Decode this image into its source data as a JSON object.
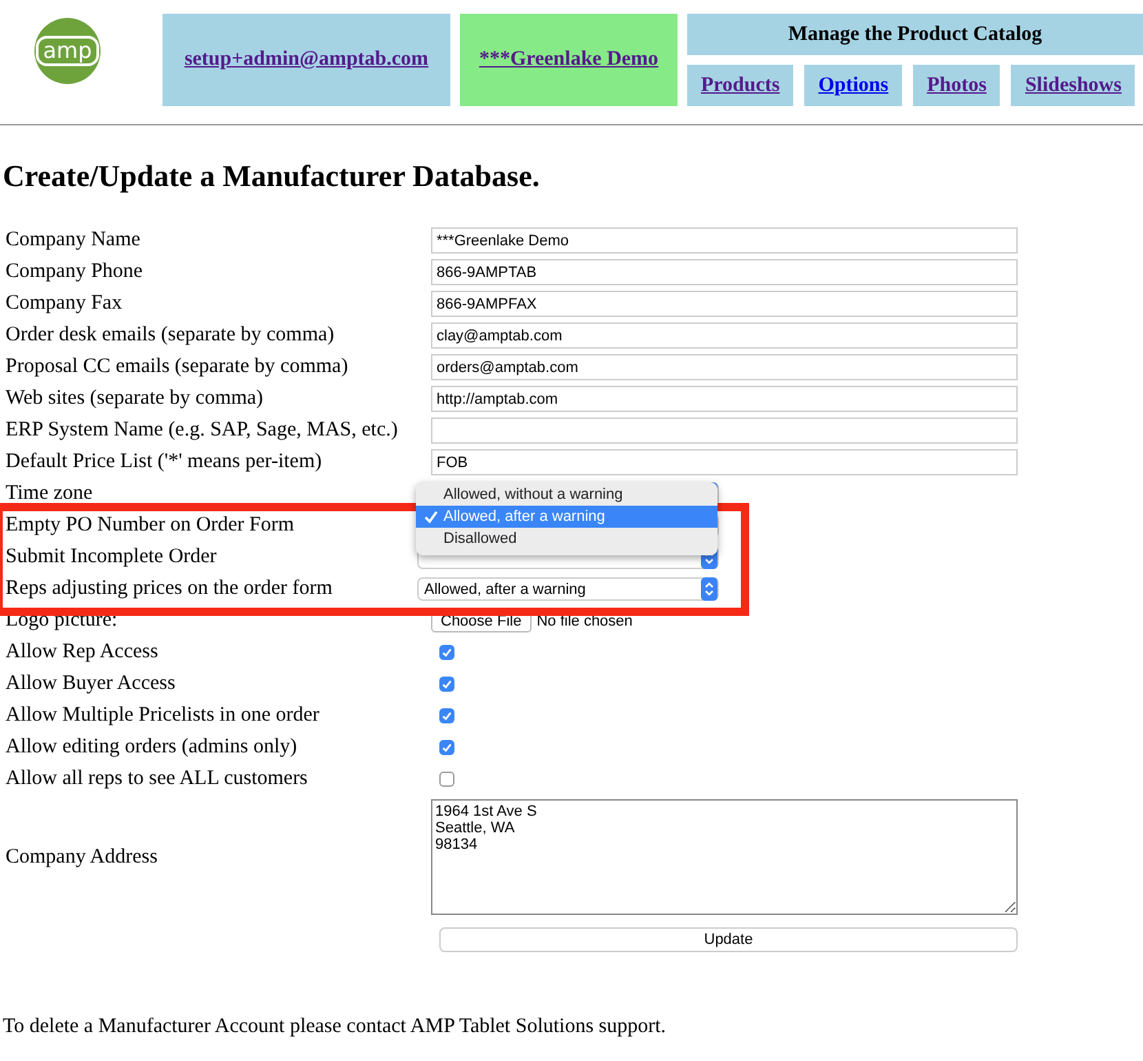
{
  "header": {
    "logo_text": "amp",
    "user_link": "setup+admin@amptab.com",
    "company_link": "***Greenlake Demo",
    "catalog_title": "Manage the Product Catalog",
    "nav": [
      {
        "label": "Products",
        "visited": true
      },
      {
        "label": "Options",
        "visited": false
      },
      {
        "label": "Photos",
        "visited": true
      },
      {
        "label": "Slideshows",
        "visited": true
      }
    ]
  },
  "title": "Create/Update a Manufacturer Database.",
  "fields": [
    {
      "kind": "text",
      "label": "Company Name",
      "value": "***Greenlake Demo"
    },
    {
      "kind": "text",
      "label": "Company Phone",
      "value": "866-9AMPTAB"
    },
    {
      "kind": "text",
      "label": "Company Fax",
      "value": "866-9AMPFAX"
    },
    {
      "kind": "text",
      "label": "Order desk emails (separate by comma)",
      "value": "clay@amptab.com"
    },
    {
      "kind": "text",
      "label": "Proposal CC emails (separate by comma)",
      "value": "orders@amptab.com"
    },
    {
      "kind": "text",
      "label": "Web sites (separate by comma)",
      "value": "http://amptab.com"
    },
    {
      "kind": "text",
      "label": "ERP System Name (e.g. SAP, Sage, MAS, etc.)"
    },
    {
      "kind": "text",
      "label": "Default Price List ('*' means per-item)",
      "value": "FOB"
    },
    {
      "kind": "select",
      "label": "Time zone"
    },
    {
      "kind": "select",
      "label": "Empty PO Number on Order Form",
      "open": true,
      "options": [
        {
          "label": "Allowed, without a warning",
          "selected": false
        },
        {
          "label": "Allowed, after a warning",
          "selected": true
        },
        {
          "label": "Disallowed",
          "selected": false
        }
      ]
    },
    {
      "kind": "select",
      "label": "Submit Incomplete Order"
    },
    {
      "kind": "select",
      "label": "Reps adjusting prices on the order form",
      "value": "Allowed, after a warning"
    },
    {
      "kind": "file",
      "label": "Logo picture:",
      "button": "Choose File",
      "status": "No file chosen"
    },
    {
      "kind": "checkbox",
      "label": "Allow Rep Access",
      "checked": true
    },
    {
      "kind": "checkbox",
      "label": "Allow Buyer Access",
      "checked": true
    },
    {
      "kind": "checkbox",
      "label": "Allow Multiple Pricelists in one order",
      "checked": true
    },
    {
      "kind": "checkbox",
      "label": "Allow editing orders (admins only)",
      "checked": true
    },
    {
      "kind": "checkbox",
      "label": "Allow all reps to see ALL customers",
      "checked": false
    },
    {
      "kind": "textarea",
      "label": "Company Address",
      "value": "1964 1st Ave S\nSeattle, WA\n98134"
    }
  ],
  "submit": "Update",
  "footer": "To delete a Manufacturer Account please contact AMP Tablet Solutions support."
}
